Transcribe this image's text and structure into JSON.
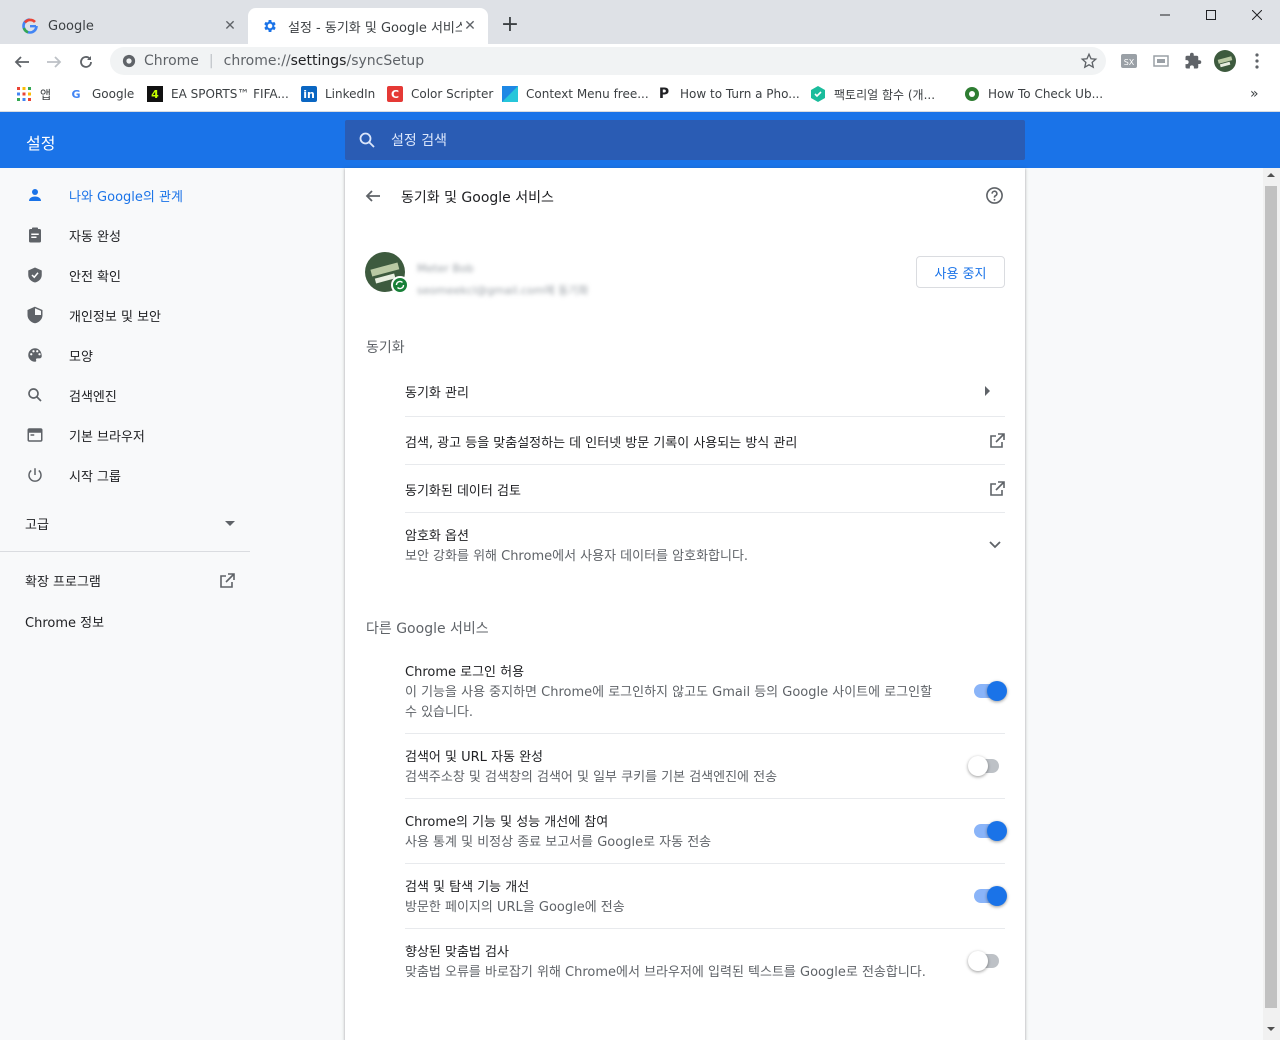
{
  "browser": {
    "tabs": [
      {
        "title": "Google",
        "icon": "google-g-icon"
      },
      {
        "title": "설정 - 동기화 및 Google 서비스",
        "icon": "settings-gear-icon"
      }
    ],
    "new_tab": "+",
    "omnibox": {
      "site_label": "Chrome",
      "url_scheme": "chrome://",
      "url_host": "settings",
      "url_path": "/syncSetup"
    },
    "bookmarks": [
      {
        "label": "앱",
        "icon": "apps-grid-icon"
      },
      {
        "label": "Google",
        "icon": "google-g-icon"
      },
      {
        "label": "EA SPORTS™ FIFA...",
        "icon": "ea-sports-icon"
      },
      {
        "label": "LinkedIn",
        "icon": "linkedin-icon"
      },
      {
        "label": "Color Scripter",
        "icon": "color-scripter-icon"
      },
      {
        "label": "Context Menu free...",
        "icon": "context-menu-icon"
      },
      {
        "label": "How to Turn a Pho...",
        "icon": "p-site-icon"
      },
      {
        "label": "팩토리얼 함수 (개...",
        "icon": "shield-site-icon"
      },
      {
        "label": "How To Check Ub...",
        "icon": "gear-site-icon"
      }
    ],
    "bookmarks_overflow": "»"
  },
  "settings": {
    "title": "설정",
    "search_placeholder": "설정 검색",
    "sidebar": {
      "items": [
        {
          "label": "나와 Google의 관계",
          "icon": "person-icon",
          "active": true
        },
        {
          "label": "자동 완성",
          "icon": "clipboard-icon"
        },
        {
          "label": "안전 확인",
          "icon": "shield-check-icon"
        },
        {
          "label": "개인정보 및 보안",
          "icon": "shield-half-icon"
        },
        {
          "label": "모양",
          "icon": "palette-icon"
        },
        {
          "label": "검색엔진",
          "icon": "search-icon"
        },
        {
          "label": "기본 브라우저",
          "icon": "browser-window-icon"
        },
        {
          "label": "시작 그룹",
          "icon": "power-icon"
        }
      ],
      "advanced": "고급",
      "extensions": "확장 프로그램",
      "about": "Chrome 정보"
    },
    "page": {
      "title": "동기화 및 Google 서비스",
      "account": {
        "name": "Meter Bob",
        "email": "seomeekcl@gmail.com에 동기화"
      },
      "stop_button": "사용 중지",
      "sync_section": "동기화",
      "sync_rows": [
        {
          "label": "동기화 관리"
        },
        {
          "label": "검색, 광고 등을 맞춤설정하는 데 인터넷 방문 기록이 사용되는 방식 관리"
        },
        {
          "label": "동기화된 데이터 검토"
        },
        {
          "label": "암호화 옵션",
          "sub": "보안 강화를 위해 Chrome에서 사용자 데이터를 암호화합니다."
        }
      ],
      "other_section": "다른 Google 서비스",
      "service_rows": [
        {
          "label": "Chrome 로그인 허용",
          "sub": "이 기능을 사용 중지하면 Chrome에 로그인하지 않고도 Gmail 등의 Google 사이트에 로그인할 수 있습니다.",
          "enabled": true
        },
        {
          "label": "검색어 및 URL 자동 완성",
          "sub": "검색주소창 및 검색창의 검색어 및 일부 쿠키를 기본 검색엔진에 전송",
          "enabled": false
        },
        {
          "label": "Chrome의 기능 및 성능 개선에 참여",
          "sub": "사용 통계 및 비정상 종료 보고서를 Google로 자동 전송",
          "enabled": true
        },
        {
          "label": "검색 및 탐색 기능 개선",
          "sub": "방문한 페이지의 URL을 Google에 전송",
          "enabled": true
        },
        {
          "label": "향상된 맞춤법 검사",
          "sub": "맞춤법 오류를 바로잡기 위해 Chrome에서 브라우저에 입력된 텍스트를 Google로 전송합니다.",
          "enabled": false
        }
      ]
    }
  },
  "colors": {
    "accent": "#1a73e8",
    "header": "#1a73e8",
    "toggle_on": "#1a73e8"
  }
}
